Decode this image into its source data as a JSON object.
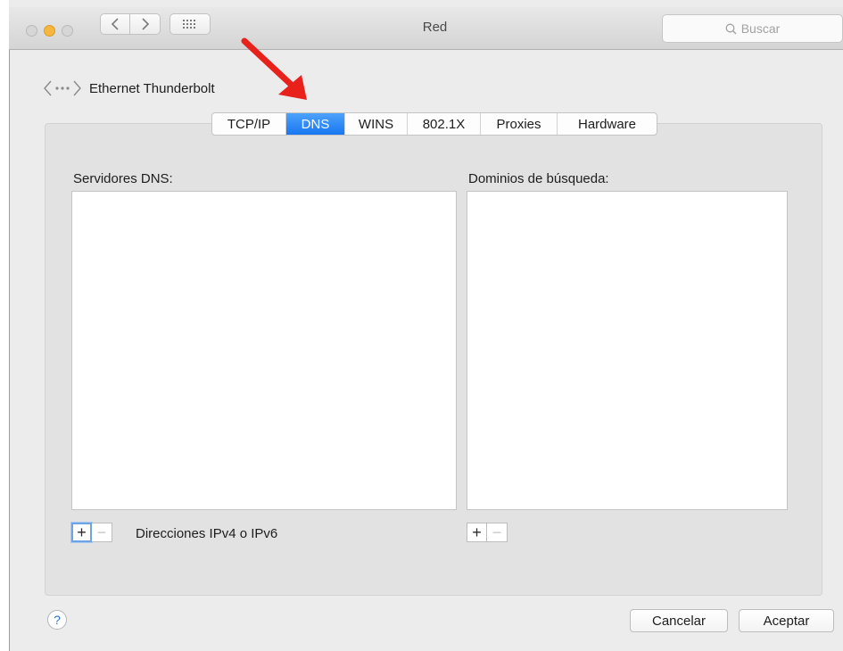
{
  "window": {
    "title": "Red",
    "search_placeholder": "Buscar"
  },
  "icons": {
    "back": "chevron-left-icon",
    "forward": "chevron-right-icon",
    "grid": "grid-icon",
    "search": "magnifier-icon",
    "interface": "ethernet-icon",
    "annotation": "red-arrow-icon"
  },
  "interface": {
    "name": "Ethernet Thunderbolt"
  },
  "tabs": [
    {
      "label": "TCP/IP"
    },
    {
      "label": "DNS",
      "active": true
    },
    {
      "label": "WINS"
    },
    {
      "label": "802.1X"
    },
    {
      "label": "Proxies"
    },
    {
      "label": "Hardware"
    }
  ],
  "dns": {
    "servers_label": "Servidores DNS:",
    "servers": [],
    "domains_label": "Dominios de búsqueda:",
    "domains": [],
    "address_hint": "Direcciones IPv4 o IPv6",
    "add_label": "+",
    "remove_label": "−"
  },
  "footer": {
    "help_label": "?",
    "cancel_label": "Cancelar",
    "ok_label": "Aceptar"
  },
  "colors": {
    "accent": "#1877f1",
    "traffic_minimize": "#f6b63f",
    "annotation_arrow": "#e8211b"
  }
}
